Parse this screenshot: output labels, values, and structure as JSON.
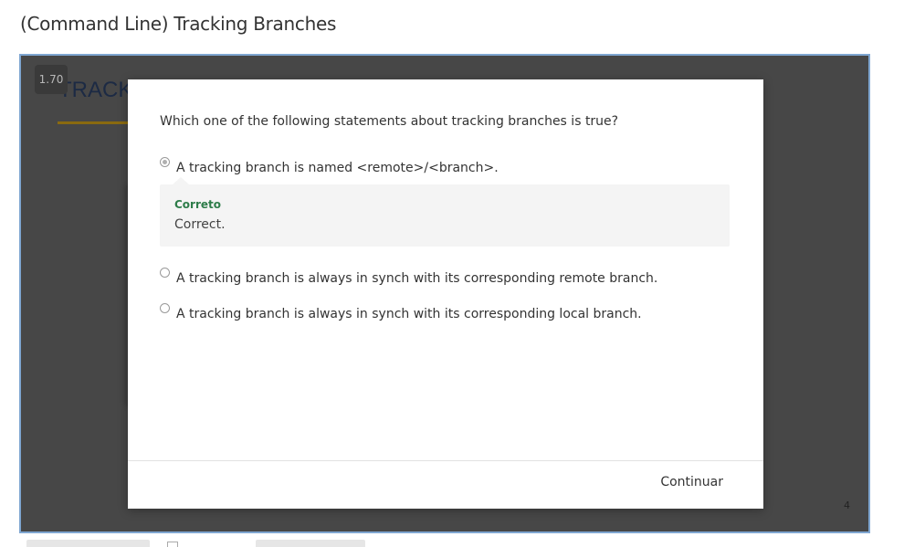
{
  "page": {
    "title": "(Command Line) Tracking Branches"
  },
  "player": {
    "speed": "1.70",
    "slide_heading": "TRACK",
    "slide_number": "4"
  },
  "quiz": {
    "question": "Which one of the following statements about tracking branches is true?",
    "options": [
      {
        "label": "A tracking branch is named <remote>/<branch>.",
        "selected": true
      },
      {
        "label": "A tracking branch is always in synch with its corresponding remote branch.",
        "selected": false
      },
      {
        "label": "A tracking branch is always in synch with its corresponding local branch.",
        "selected": false
      }
    ],
    "feedback": {
      "status": "Correto",
      "message": "Correct."
    },
    "continue_label": "Continuar"
  },
  "colors": {
    "frame_border": "#7fa6d1",
    "feedback_status": "#2e7d4a",
    "slide_underline": "#8a6a10"
  },
  "icons": {
    "selected_radio": "radio-checked-icon",
    "unselected_radio": "radio-unchecked-icon"
  }
}
